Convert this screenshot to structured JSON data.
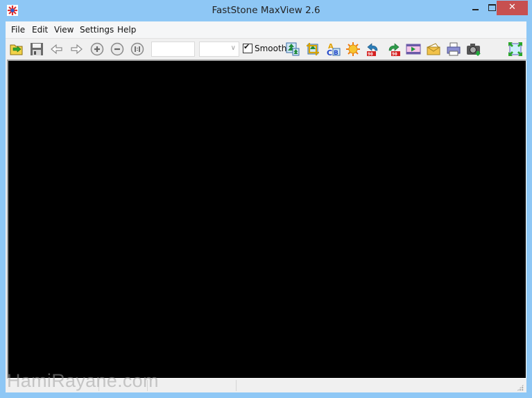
{
  "window": {
    "title": "FastStone MaxView 2.6",
    "controls": {
      "minimize": "minimize",
      "maximize": "maximize",
      "close": "✕"
    }
  },
  "menu": {
    "items": [
      {
        "label": "File"
      },
      {
        "label": "Edit"
      },
      {
        "label": "View"
      },
      {
        "label": "Settings"
      },
      {
        "label": "Help"
      }
    ]
  },
  "toolbar": {
    "buttons": [
      {
        "icon": "open-folder-icon"
      },
      {
        "icon": "save-disk-icon"
      },
      {
        "icon": "arrow-left-icon"
      },
      {
        "icon": "arrow-right-icon"
      },
      {
        "icon": "zoom-in-icon"
      },
      {
        "icon": "zoom-out-icon"
      },
      {
        "icon": "actual-size-icon"
      },
      {
        "icon": "resize-image-icon"
      },
      {
        "icon": "crop-icon"
      },
      {
        "icon": "text-caption-icon"
      },
      {
        "icon": "brightness-sun-icon"
      },
      {
        "icon": "rotate-left-90-icon"
      },
      {
        "icon": "rotate-right-90-icon"
      },
      {
        "icon": "slideshow-icon"
      },
      {
        "icon": "email-envelope-icon"
      },
      {
        "icon": "print-icon"
      },
      {
        "icon": "screen-capture-camera-icon"
      },
      {
        "icon": "fullscreen-icon"
      }
    ],
    "zoom_value": "",
    "zoom_select_value": "",
    "smooth": {
      "label": "Smooth",
      "checked": true
    }
  },
  "statusbar": {
    "segments": [
      "",
      "",
      "",
      ""
    ]
  },
  "watermark": "HamiRayane.com",
  "colors": {
    "titlebar": "#8ec7f5",
    "close": "#c75050",
    "viewer_bg": "#000000"
  }
}
